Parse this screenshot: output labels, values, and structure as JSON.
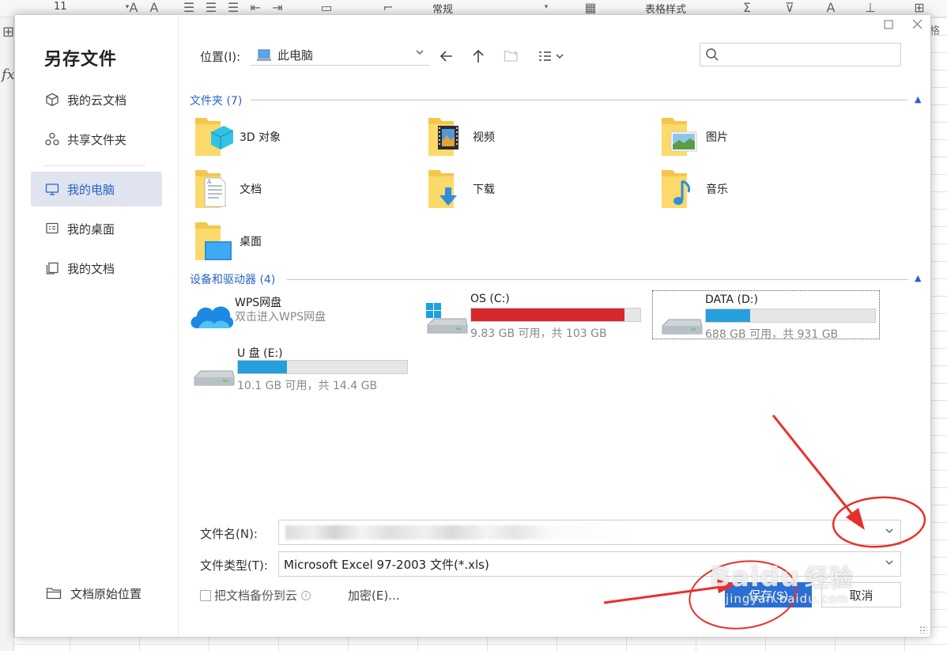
{
  "background": {
    "font_size": "11",
    "number_format": "常规",
    "table_style": "表格样式",
    "fx": "fx",
    "right_text": "格"
  },
  "dialog": {
    "title": "另存文件",
    "sidebar": {
      "items": [
        {
          "label": "我的云文档",
          "icon": "cube-icon"
        },
        {
          "label": "共享文件夹",
          "icon": "share-icon"
        },
        {
          "label": "我的电脑",
          "icon": "monitor-icon",
          "active": true
        },
        {
          "label": "我的桌面",
          "icon": "desktop-icon"
        },
        {
          "label": "我的文档",
          "icon": "documents-icon"
        }
      ],
      "origin_location": "文档原始位置"
    },
    "location": {
      "label": "位置(I):",
      "value": "此电脑"
    },
    "search": {
      "placeholder": ""
    },
    "folders_section": {
      "title": "文件夹 (7)",
      "items": [
        {
          "name": "3D 对象",
          "icon": "3d-objects-folder-icon"
        },
        {
          "name": "视频",
          "icon": "videos-folder-icon"
        },
        {
          "name": "图片",
          "icon": "pictures-folder-icon"
        },
        {
          "name": "文档",
          "icon": "documents-folder-icon"
        },
        {
          "name": "下载",
          "icon": "downloads-folder-icon"
        },
        {
          "name": "音乐",
          "icon": "music-folder-icon"
        },
        {
          "name": "桌面",
          "icon": "desktop-folder-icon"
        }
      ]
    },
    "devices_section": {
      "title": "设备和驱动器 (4)",
      "wps": {
        "name": "WPS网盘",
        "subtitle": "双击进入WPS网盘"
      },
      "drives": [
        {
          "name": "OS (C:)",
          "info": "9.83 GB 可用，共 103 GB",
          "used_fraction": 0.905,
          "color": "#d8282c"
        },
        {
          "name": "DATA (D:)",
          "info": "688 GB 可用，共 931 GB",
          "used_fraction": 0.26,
          "color": "#26a0da",
          "selected": true
        },
        {
          "name": "U 盘 (E:)",
          "info": "10.1 GB 可用，共 14.4 GB",
          "used_fraction": 0.29,
          "color": "#26a0da"
        }
      ]
    },
    "filename": {
      "label": "文件名(N):",
      "value": ""
    },
    "filetype": {
      "label": "文件类型(T):",
      "value": "Microsoft Excel 97-2003 文件(*.xls)"
    },
    "backup_checkbox": "把文档备份到云",
    "encrypt_link": "加密(E)...",
    "save_button": "保存(S)",
    "cancel_button": "取消"
  },
  "watermark": {
    "brand": "Baidu",
    "brand_cn": "经验",
    "url": "jingyan.baidu.com"
  },
  "colors": {
    "accent": "#2a62c9",
    "save_button": "#2a6fd6",
    "annotation": "#e8302a"
  }
}
